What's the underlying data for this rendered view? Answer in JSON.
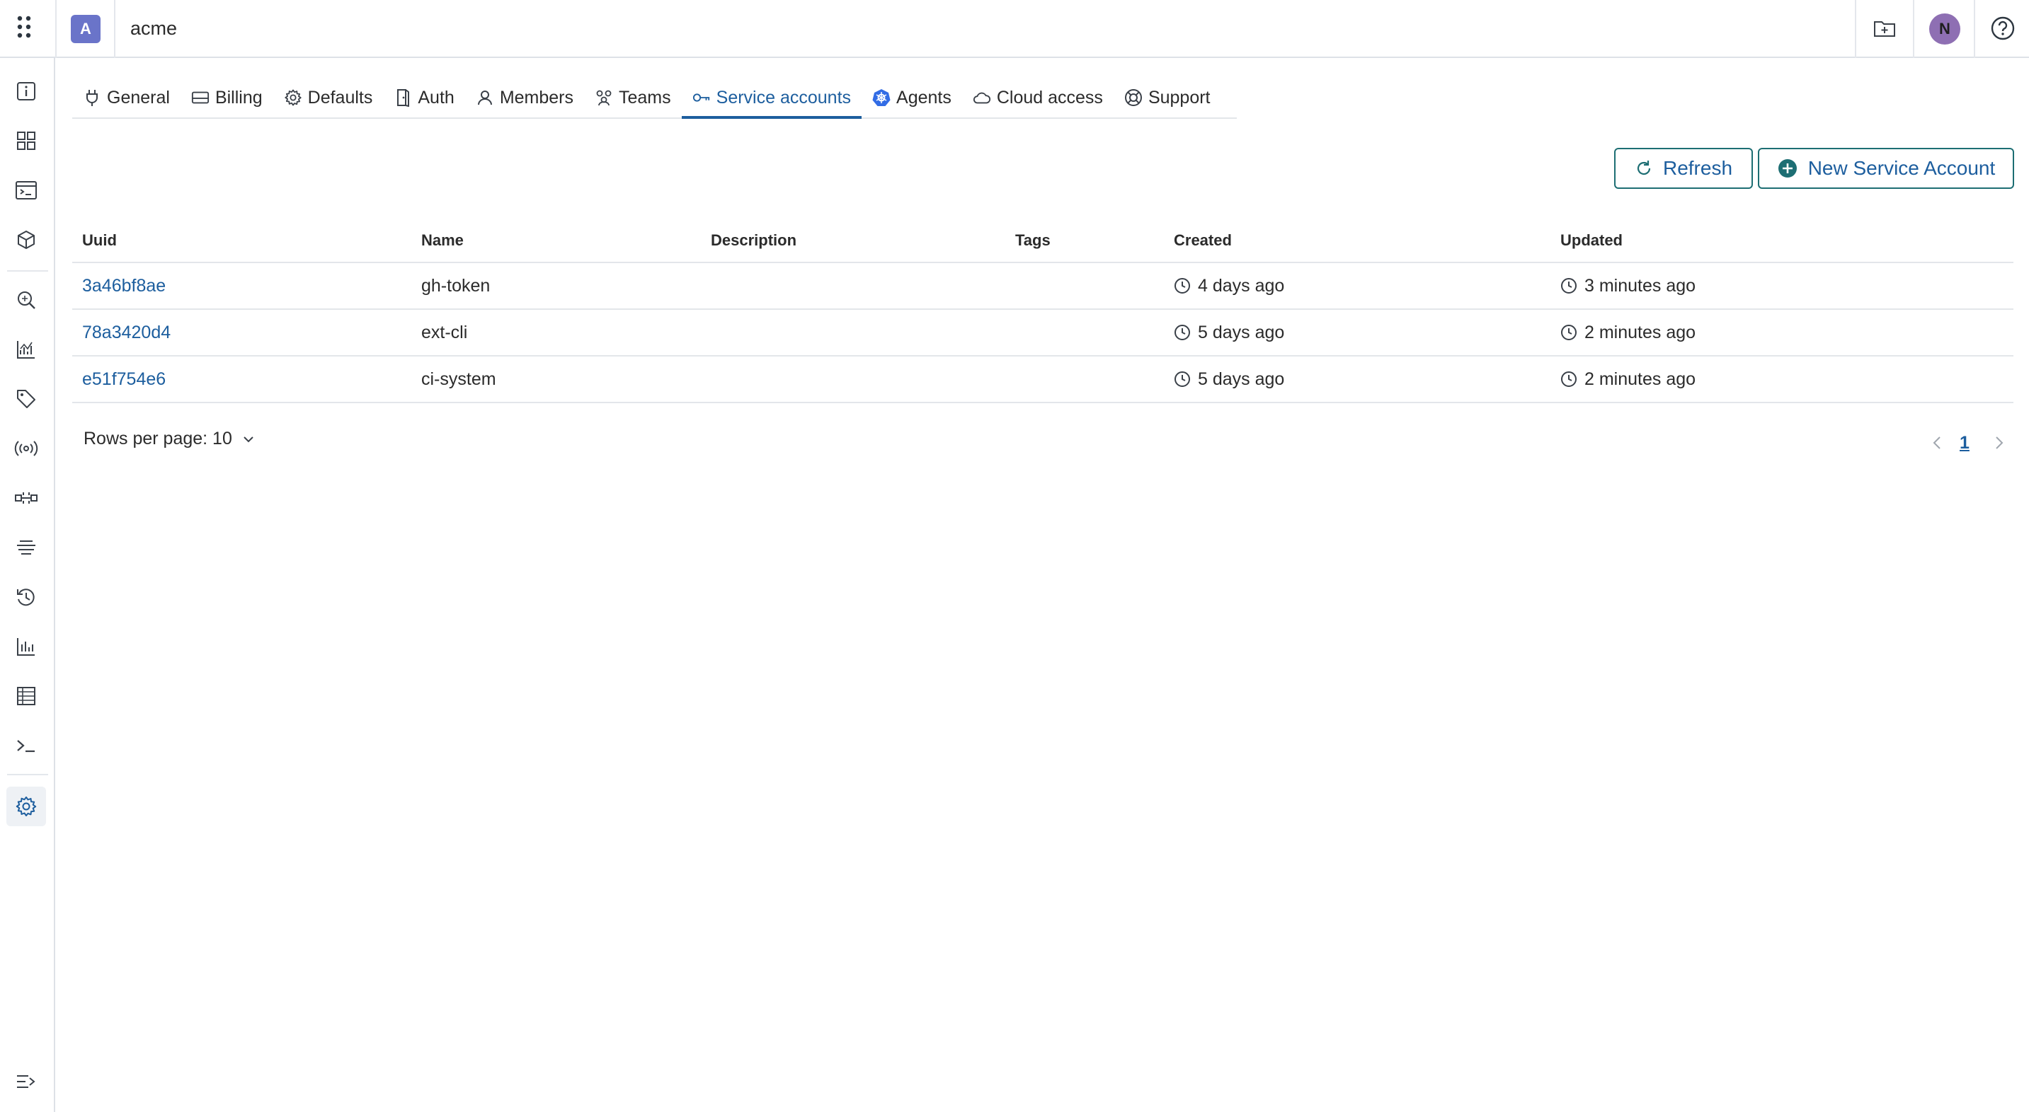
{
  "topbar": {
    "org_initial": "A",
    "org_name": "acme",
    "user_initial": "N",
    "icons": [
      "apps-grid-icon",
      "folder-add-icon",
      "help-icon"
    ]
  },
  "sidebar": {
    "icons": [
      "info-icon",
      "dashboard-grid-icon",
      "terminal-window-icon",
      "box-icon",
      "search-icon",
      "analytics-icon",
      "tag-icon",
      "broadcast-icon",
      "pipeline-icon",
      "filter-lines-icon",
      "history-icon",
      "bar-chart-icon",
      "table-list-icon",
      "shell-prompt-icon",
      "settings-gear-icon",
      "collapse-sidebar-icon"
    ],
    "active": "settings-gear-icon"
  },
  "tabs": [
    {
      "label": "General",
      "icon": "plug-icon"
    },
    {
      "label": "Billing",
      "icon": "credit-card-icon"
    },
    {
      "label": "Defaults",
      "icon": "gear-icon"
    },
    {
      "label": "Auth",
      "icon": "door-icon"
    },
    {
      "label": "Members",
      "icon": "person-icon"
    },
    {
      "label": "Teams",
      "icon": "team-icon"
    },
    {
      "label": "Service accounts",
      "icon": "key-icon",
      "active": true
    },
    {
      "label": "Agents",
      "icon": "kubernetes-icon"
    },
    {
      "label": "Cloud access",
      "icon": "cloud-icon"
    },
    {
      "label": "Support",
      "icon": "lifebuoy-icon"
    }
  ],
  "actions": {
    "refresh_label": "Refresh",
    "new_label": "New Service Account"
  },
  "table": {
    "columns": [
      "Uuid",
      "Name",
      "Description",
      "Tags",
      "Created",
      "Updated"
    ],
    "rows": [
      {
        "uuid": "3a46bf8ae",
        "name": "gh-token",
        "description": "",
        "tags": "",
        "created": "4 days ago",
        "updated": "3 minutes ago"
      },
      {
        "uuid": "78a3420d4",
        "name": "ext-cli",
        "description": "",
        "tags": "",
        "created": "5 days ago",
        "updated": "2 minutes ago"
      },
      {
        "uuid": "e51f754e6",
        "name": "ci-system",
        "description": "",
        "tags": "",
        "created": "5 days ago",
        "updated": "2 minutes ago"
      }
    ]
  },
  "pagination": {
    "rows_per_page_label": "Rows per page: 10",
    "current_page": "1"
  },
  "colors": {
    "accent": "#1d5e9e",
    "button_border": "#1d6e73",
    "org_avatar": "#6a74c9",
    "user_avatar": "#8e6fb3",
    "agents_icon": "#326ce5"
  }
}
